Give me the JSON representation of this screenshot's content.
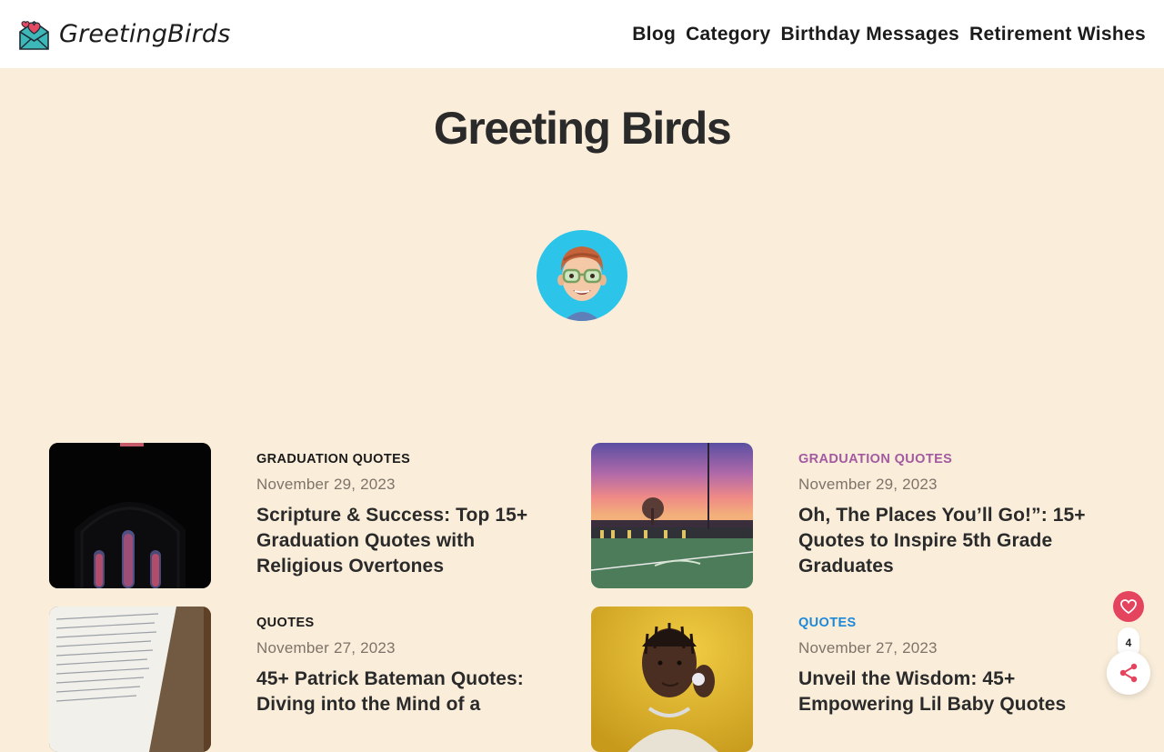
{
  "brand": {
    "name": "GreetingBirds"
  },
  "nav": {
    "items": [
      {
        "label": "Blog"
      },
      {
        "label": "Category"
      },
      {
        "label": "Birthday Messages"
      },
      {
        "label": "Retirement Wishes"
      }
    ]
  },
  "page": {
    "title": "Greeting Birds"
  },
  "posts": [
    {
      "category": "GRADUATION QUOTES",
      "category_color": "#1b1b1b",
      "date": "November 29, 2023",
      "title": "Scripture & Success: Top 15+ Graduation Quotes with Religious Overtones",
      "thumb": "church-stained-glass"
    },
    {
      "category": "GRADUATION QUOTES",
      "category_color": "#a35aa0",
      "date": "November 29, 2023",
      "title": "Oh, The Places You’ll Go!”: 15+ Quotes to Inspire 5th Grade Graduates",
      "thumb": "stadium-sunset"
    },
    {
      "category": "QUOTES",
      "category_color": "#1b1b1b",
      "date": "November 27, 2023",
      "title": "45+ Patrick Bateman Quotes: Diving into the Mind of a",
      "thumb": "open-book"
    },
    {
      "category": "QUOTES",
      "category_color": "#1e88d8",
      "date": "November 27, 2023",
      "title": "Unveil the Wisdom: 45+ Empowering Lil Baby Quotes",
      "thumb": "portrait-yellow"
    }
  ],
  "floating": {
    "like_count": "4",
    "heart_color": "#e4445d",
    "share_color": "#e4445d"
  }
}
